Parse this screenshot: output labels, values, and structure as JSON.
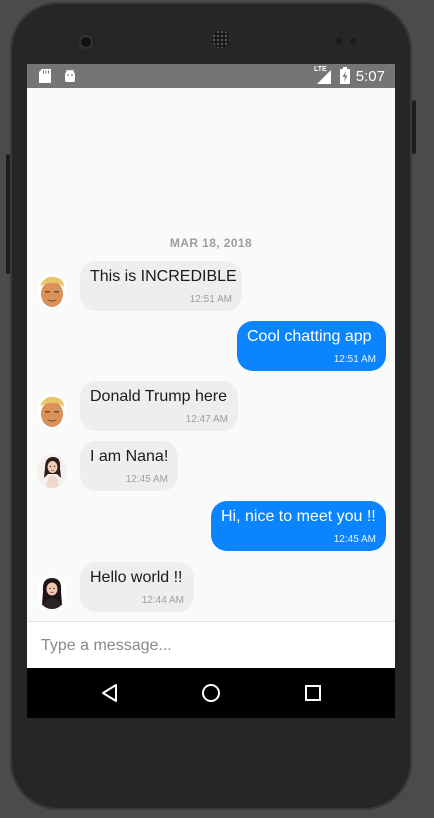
{
  "status_bar": {
    "time": "5:07",
    "network": "LTE",
    "left_icons": [
      "sd-card-icon",
      "android-icon"
    ]
  },
  "chat": {
    "date_separator": "MAR 18, 2018",
    "messages": [
      {
        "direction": "in",
        "sender_avatar": "trump-avatar",
        "text": "This is INCREDIBLE",
        "time": "12:51 AM"
      },
      {
        "direction": "out",
        "text": "Cool chatting app",
        "time": "12:51 AM"
      },
      {
        "direction": "in",
        "sender_avatar": "trump-avatar",
        "text": "Donald Trump here",
        "time": "12:47 AM"
      },
      {
        "direction": "in",
        "sender_avatar": "nana-avatar",
        "text": "I am Nana!",
        "time": "12:45 AM"
      },
      {
        "direction": "out",
        "text": "Hi, nice to meet you !!",
        "time": "12:45 AM"
      },
      {
        "direction": "in",
        "sender_avatar": "girl-avatar",
        "text": "Hello world !!",
        "time": "12:44 AM"
      }
    ]
  },
  "composer": {
    "placeholder": "Type a message...",
    "value": ""
  },
  "nav_bar": {
    "buttons": [
      "back-icon",
      "home-icon",
      "recents-icon"
    ]
  },
  "colors": {
    "outgoing_bubble": "#0a84ff",
    "incoming_bubble": "#eeeeee",
    "status_bar": "#757575",
    "nav_bar": "#000000"
  }
}
